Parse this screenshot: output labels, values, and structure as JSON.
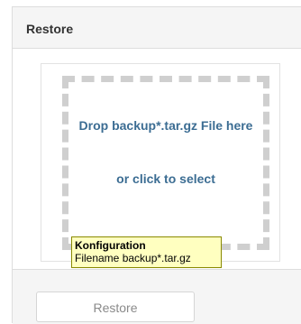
{
  "panel": {
    "title": "Restore"
  },
  "dropzone": {
    "line1": "Drop backup*.tar.gz File here",
    "line2": "or click to select"
  },
  "tooltip": {
    "title": "Konfiguration",
    "text": "Filename backup*.tar.gz"
  },
  "footer": {
    "restore_label": "Restore",
    "restore_disabled": true
  },
  "colors": {
    "header_bg": "#f5f5f5",
    "dropzone_text": "#3c6d93",
    "dropzone_border": "#cfcfcf",
    "tooltip_bg": "#ffffc0"
  }
}
